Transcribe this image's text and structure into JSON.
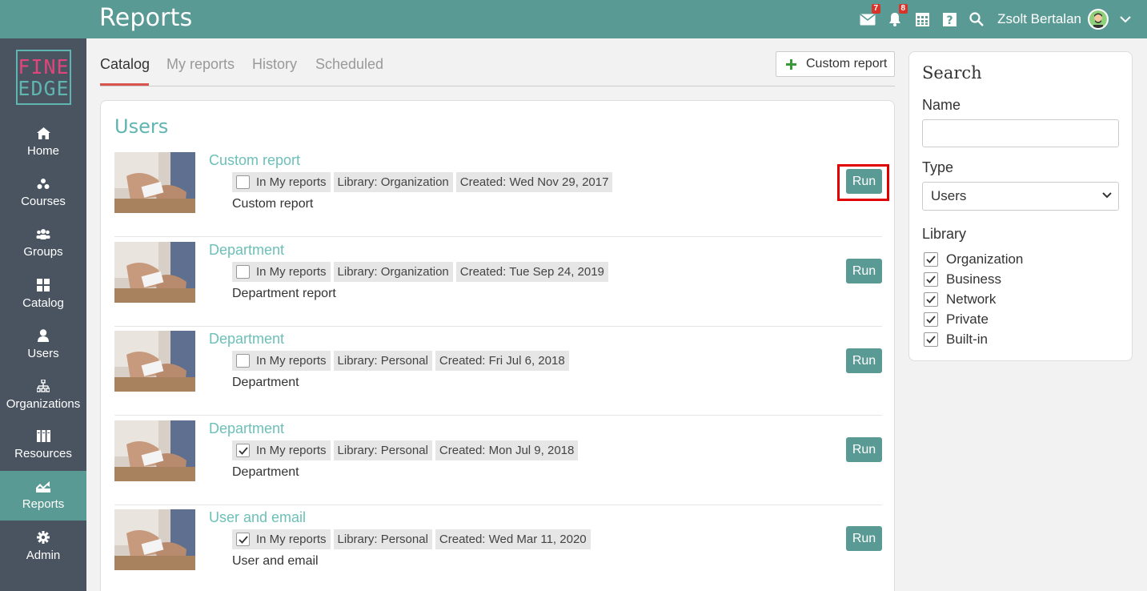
{
  "header": {
    "title": "Reports",
    "mail_badge": "7",
    "notif_badge": "8",
    "user_name": "Zsolt Bertalan"
  },
  "logo": {
    "line1": "FINE",
    "line2": "EDGE"
  },
  "sidebar": {
    "items": [
      {
        "label": "Home",
        "icon": "home-icon"
      },
      {
        "label": "Courses",
        "icon": "courses-icon"
      },
      {
        "label": "Groups",
        "icon": "groups-icon"
      },
      {
        "label": "Catalog",
        "icon": "catalog-icon"
      },
      {
        "label": "Users",
        "icon": "user-icon"
      },
      {
        "label": "Organizations",
        "icon": "org-icon"
      },
      {
        "label": "Resources",
        "icon": "resources-icon"
      },
      {
        "label": "Reports",
        "icon": "reports-icon",
        "active": true
      },
      {
        "label": "Admin",
        "icon": "gear-icon"
      }
    ]
  },
  "tabs": [
    {
      "label": "Catalog",
      "active": true
    },
    {
      "label": "My reports"
    },
    {
      "label": "History"
    },
    {
      "label": "Scheduled"
    }
  ],
  "custom_report_button": "Custom report",
  "section_title": "Users",
  "reports": [
    {
      "title": "Custom report",
      "in_my_reports_label": "In My reports",
      "checked": false,
      "library": "Library: Organization",
      "created": "Created: Wed Nov 29, 2017",
      "description": "Custom report",
      "run": "Run"
    },
    {
      "title": "Department",
      "in_my_reports_label": "In My reports",
      "checked": false,
      "library": "Library: Organization",
      "created": "Created: Tue Sep 24, 2019",
      "description": "Department report",
      "run": "Run"
    },
    {
      "title": "Department",
      "in_my_reports_label": "In My reports",
      "checked": false,
      "library": "Library: Personal",
      "created": "Created: Fri Jul 6, 2018",
      "description": "Department",
      "run": "Run"
    },
    {
      "title": "Department",
      "in_my_reports_label": "In My reports",
      "checked": true,
      "library": "Library: Personal",
      "created": "Created: Mon Jul 9, 2018",
      "description": "Department",
      "run": "Run"
    },
    {
      "title": "User and email",
      "in_my_reports_label": "In My reports",
      "checked": true,
      "library": "Library: Personal",
      "created": "Created: Wed Mar 11, 2020",
      "description": "User and email",
      "run": "Run"
    }
  ],
  "search": {
    "title": "Search",
    "name_label": "Name",
    "name_value": "",
    "type_label": "Type",
    "type_value": "Users",
    "library_label": "Library",
    "library_options": [
      {
        "label": "Organization",
        "checked": true
      },
      {
        "label": "Business",
        "checked": true
      },
      {
        "label": "Network",
        "checked": true
      },
      {
        "label": "Private",
        "checked": true
      },
      {
        "label": "Built-in",
        "checked": true
      }
    ]
  },
  "colors": {
    "topbar": "#5a9a94",
    "sidebar": "#4a5460",
    "accent_teal": "#6cc0b8",
    "tab_underline": "#d9534f",
    "badge": "#d9342b",
    "highlight": "#e00000"
  }
}
